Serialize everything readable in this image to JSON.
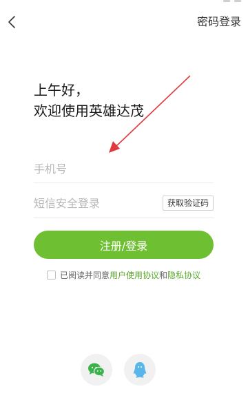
{
  "top_bar": {
    "password_login_label": "密码登录",
    "back_icon": "chevron-left-icon"
  },
  "greeting": {
    "line1": "上午好，",
    "line2": "欢迎使用英雄达茂"
  },
  "form": {
    "phone_placeholder": "手机号",
    "sms_placeholder": "短信安全登录",
    "get_code_label": "获取验证码",
    "submit_label": "注册/登录"
  },
  "agreement": {
    "prefix": "已阅读并同意",
    "user_agreement": "用户使用协议",
    "conjunction": "和",
    "privacy_policy": "隐私协议"
  },
  "social": {
    "wechat_icon": "wechat-icon",
    "qq_icon": "qq-icon"
  },
  "colors": {
    "accent": "#6fbf33",
    "link": "#5aa72a",
    "annotation": "#e0393e",
    "wechat": "#3cb34a",
    "qq": "#5ab6e8"
  }
}
